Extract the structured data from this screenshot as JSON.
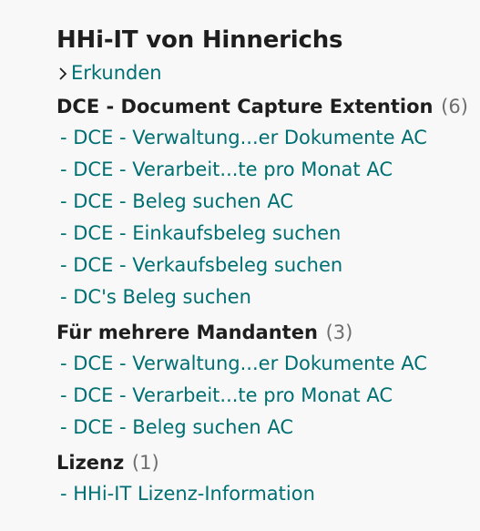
{
  "page": {
    "title": "HHi-IT von Hinnerichs",
    "explore_label": "Erkunden"
  },
  "colors": {
    "link": "#006f73",
    "heading": "#1e1e1e",
    "count": "#6e6e6e",
    "background": "#f8f8f8"
  },
  "icons": {
    "explore": "chevron-right-icon"
  },
  "groups": [
    {
      "name": "DCE - Document Capture Extention",
      "count": "(6)",
      "items": [
        "- DCE - Verwaltung...er Dokumente AC",
        "- DCE - Verarbeit...te pro Monat AC",
        "- DCE - Beleg suchen AC",
        "- DCE - Einkaufsbeleg suchen",
        "- DCE - Verkaufsbeleg suchen",
        "- DC's Beleg suchen"
      ]
    },
    {
      "name": "Für mehrere Mandanten",
      "count": "(3)",
      "items": [
        "- DCE - Verwaltung...er Dokumente AC",
        "- DCE - Verarbeit...te pro Monat AC",
        "- DCE - Beleg suchen AC"
      ]
    },
    {
      "name": "Lizenz",
      "count": "(1)",
      "items": [
        "- HHi-IT Lizenz-Information"
      ]
    }
  ]
}
